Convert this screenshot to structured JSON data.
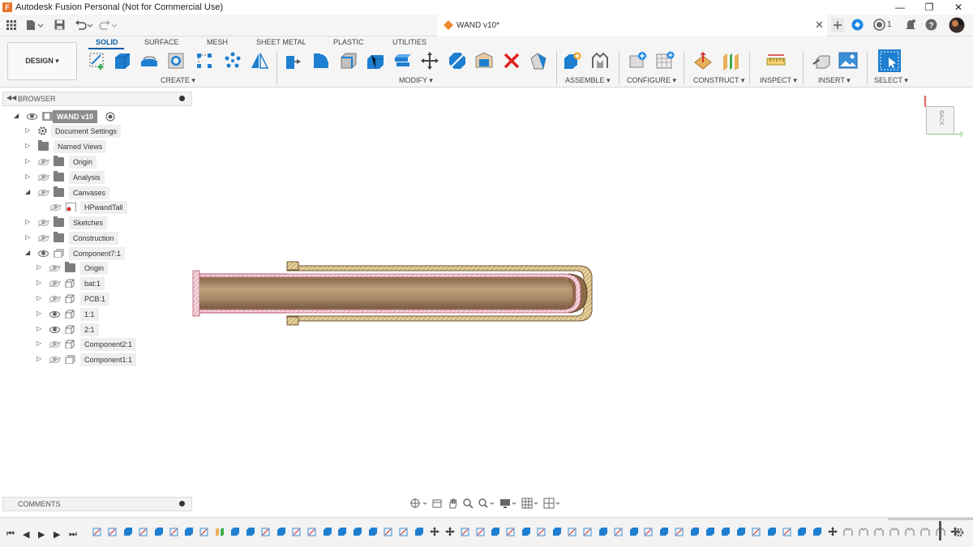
{
  "app": {
    "title": "Autodesk Fusion Personal (Not for Commercial Use)",
    "logo_letter": "F",
    "window_buttons": [
      "—",
      "❐",
      "✕"
    ]
  },
  "document": {
    "tab_name": "WAND v10*",
    "notification_count": "1"
  },
  "toolbar": {
    "workspace_button": "DESIGN ▾",
    "tabs": [
      "SOLID",
      "SURFACE",
      "MESH",
      "SHEET METAL",
      "PLASTIC",
      "UTILITIES"
    ],
    "active_tab": "SOLID",
    "groups": [
      "CREATE ▾",
      "MODIFY ▾",
      "ASSEMBLE ▾",
      "CONFIGURE ▾",
      "CONSTRUCT ▾",
      "INSPECT ▾",
      "INSERT ▾",
      "SELECT ▾"
    ]
  },
  "browser": {
    "title": "BROWSER",
    "items": [
      {
        "label": "WAND v10",
        "kind": "root"
      },
      {
        "label": "Document Settings",
        "kind": "settings"
      },
      {
        "label": "Named Views",
        "kind": "folder"
      },
      {
        "label": "Origin",
        "kind": "folder"
      },
      {
        "label": "Analysis",
        "kind": "folder"
      },
      {
        "label": "Canvases",
        "kind": "folder"
      },
      {
        "label": "HPwandTall",
        "kind": "canvas"
      },
      {
        "label": "Sketches",
        "kind": "folder"
      },
      {
        "label": "Construction",
        "kind": "folder"
      },
      {
        "label": "Component7:1",
        "kind": "component"
      },
      {
        "label": "Origin",
        "kind": "folder"
      },
      {
        "label": "bat:1",
        "kind": "body"
      },
      {
        "label": "PCB:1",
        "kind": "body"
      },
      {
        "label": "1:1",
        "kind": "body"
      },
      {
        "label": "2:1",
        "kind": "body"
      },
      {
        "label": "Component2:1",
        "kind": "body"
      },
      {
        "label": "Component1:1",
        "kind": "component"
      }
    ]
  },
  "comments": {
    "title": "COMMENTS"
  },
  "viewcube": {
    "face": "BACK",
    "axis_x": "x",
    "axis_y": "y"
  },
  "colors": {
    "accent": "#0b5ea8",
    "part_outer": "#c9ae82",
    "part_inner": "#a07a55",
    "section_hatch": "#e9a3b0",
    "toolbar_blue": "#1e7fd1",
    "toolbar_red": "#e02020"
  }
}
